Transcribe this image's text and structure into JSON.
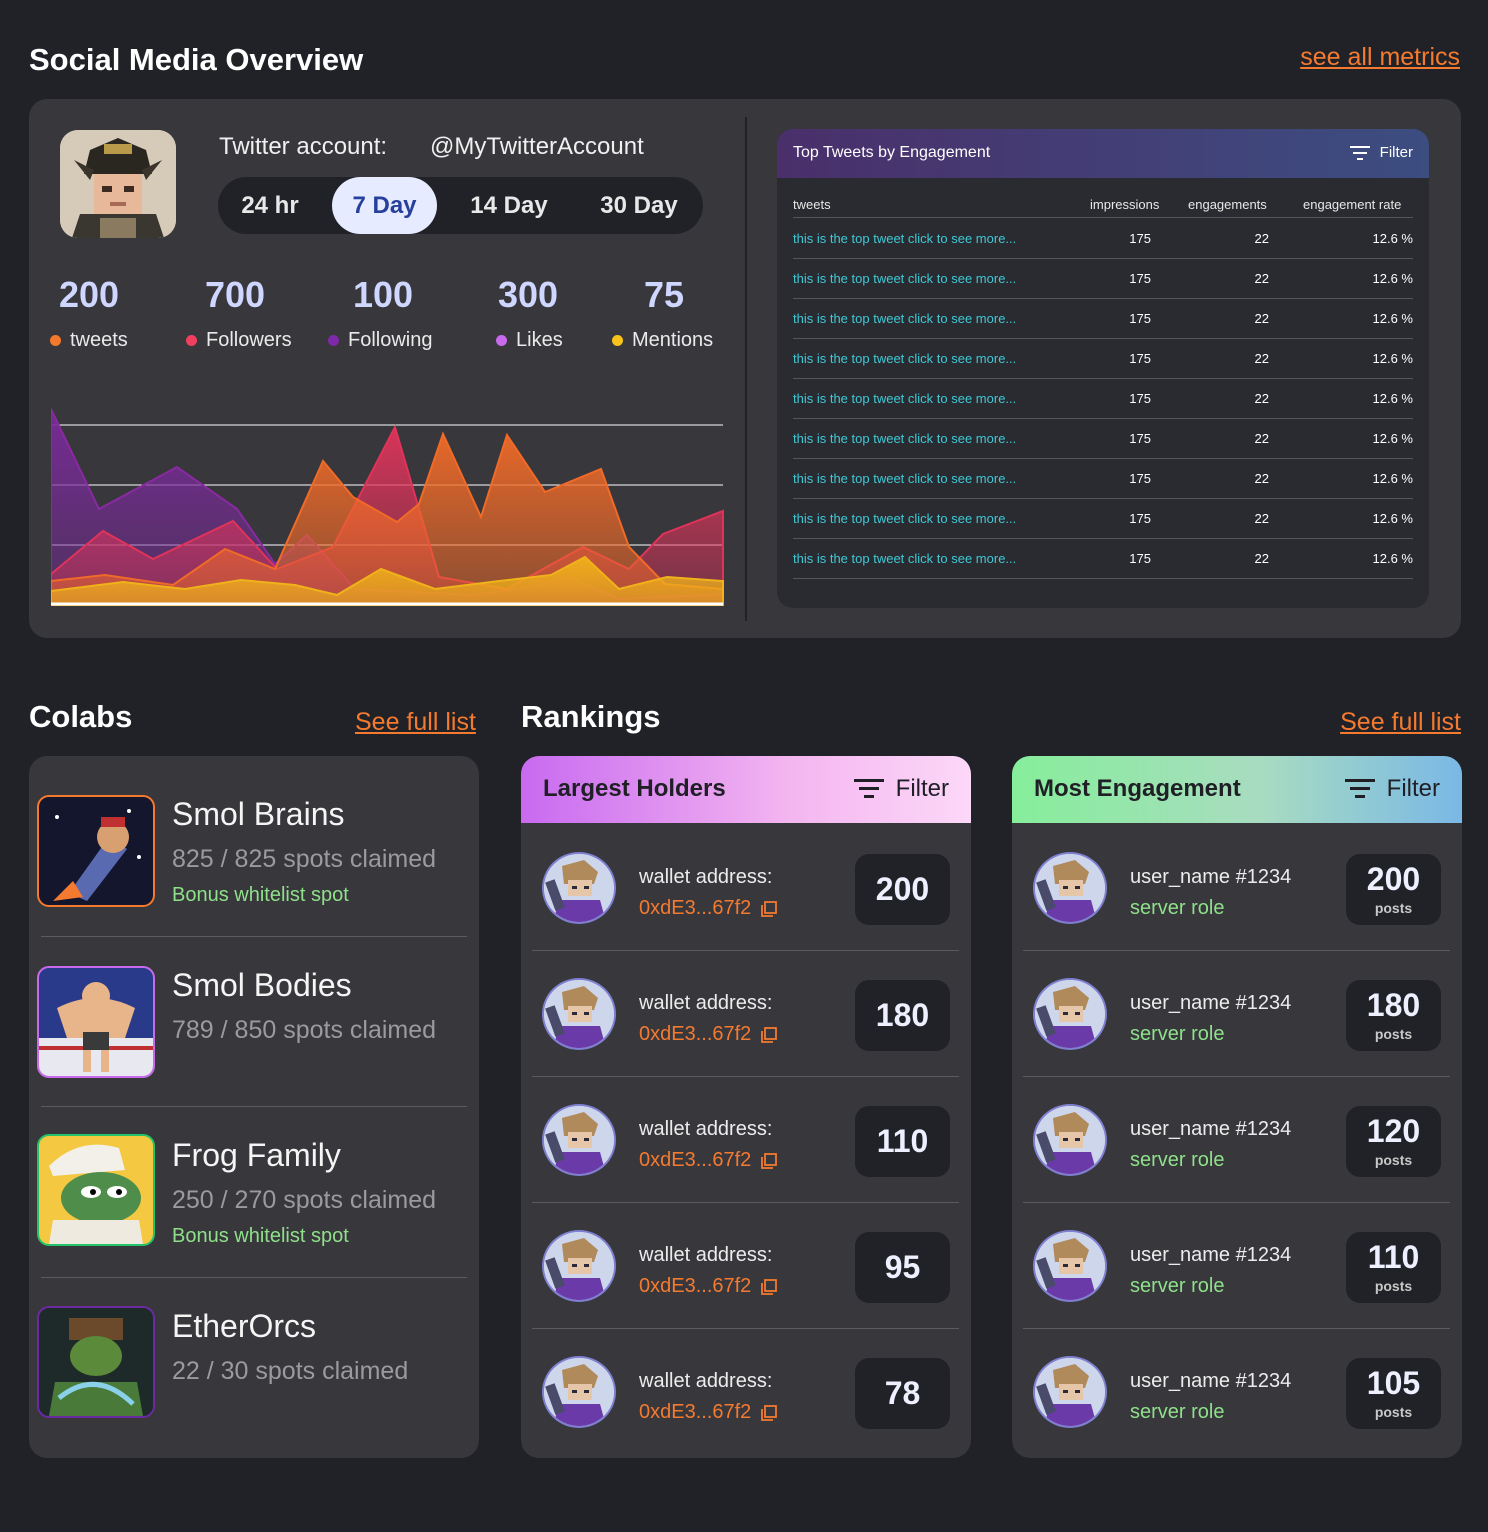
{
  "overview": {
    "title": "Social Media Overview",
    "see_all": "see all metrics",
    "twitter_label": "Twitter account:",
    "twitter_handle": "@MyTwitterAccount",
    "periods": [
      "24 hr",
      "7 Day",
      "14 Day",
      "30 Day"
    ],
    "active_period": "7 Day",
    "stats": [
      {
        "value": "200",
        "label": "tweets",
        "color": "#f4792c"
      },
      {
        "value": "700",
        "label": "Followers",
        "color": "#f33f5f"
      },
      {
        "value": "100",
        "label": "Following",
        "color": "#7d2aa8"
      },
      {
        "value": "300",
        "label": "Likes",
        "color": "#c76bea"
      },
      {
        "value": "75",
        "label": "Mentions",
        "color": "#f7c31a"
      }
    ]
  },
  "top_tweets": {
    "title": "Top Tweets by Engagement",
    "filter": "Filter",
    "columns": [
      "tweets",
      "impressions",
      "engagements",
      "engagement rate"
    ],
    "rows": [
      [
        "this is the top tweet click to see more...",
        "175",
        "22",
        "12.6 %"
      ],
      [
        "this is the top tweet click to see more...",
        "175",
        "22",
        "12.6 %"
      ],
      [
        "this is the top tweet click to see more...",
        "175",
        "22",
        "12.6 %"
      ],
      [
        "this is the top tweet click to see more...",
        "175",
        "22",
        "12.6 %"
      ],
      [
        "this is the top tweet click to see more...",
        "175",
        "22",
        "12.6 %"
      ],
      [
        "this is the top tweet click to see more...",
        "175",
        "22",
        "12.6 %"
      ],
      [
        "this is the top tweet click to see more...",
        "175",
        "22",
        "12.6 %"
      ],
      [
        "this is the top tweet click to see more...",
        "175",
        "22",
        "12.6 %"
      ],
      [
        "this is the top tweet click to see more...",
        "175",
        "22",
        "12.6 %"
      ]
    ]
  },
  "colabs": {
    "title": "Colabs",
    "see_full": "See full list",
    "items": [
      {
        "name": "Smol Brains",
        "spots": "825 / 825 spots claimed",
        "bonus": "Bonus whitelist spot",
        "border": "#f4792c"
      },
      {
        "name": "Smol Bodies",
        "spots": "789 / 850 spots claimed",
        "bonus": "",
        "border": "#c76bea"
      },
      {
        "name": "Frog Family",
        "spots": "250 / 270 spots claimed",
        "bonus": "Bonus whitelist spot",
        "border": "#23c26b"
      },
      {
        "name": "EtherOrcs",
        "spots": "22 / 30 spots claimed",
        "bonus": "",
        "border": "#6b2aa0"
      }
    ]
  },
  "rankings": {
    "title": "Rankings",
    "see_full": "See full list",
    "holders": {
      "title": "Largest Holders",
      "filter": "Filter",
      "rows": [
        {
          "label": "wallet address:",
          "address": "0xdE3...67f2",
          "value": "200"
        },
        {
          "label": "wallet address:",
          "address": "0xdE3...67f2",
          "value": "180"
        },
        {
          "label": "wallet address:",
          "address": "0xdE3...67f2",
          "value": "110"
        },
        {
          "label": "wallet address:",
          "address": "0xdE3...67f2",
          "value": "95"
        },
        {
          "label": "wallet address:",
          "address": "0xdE3...67f2",
          "value": "78"
        }
      ]
    },
    "engagement": {
      "title": "Most Engagement",
      "filter": "Filter",
      "unit": "posts",
      "rows": [
        {
          "user": "user_name #1234",
          "role": "server role",
          "value": "200"
        },
        {
          "user": "user_name #1234",
          "role": "server role",
          "value": "180"
        },
        {
          "user": "user_name #1234",
          "role": "server role",
          "value": "120"
        },
        {
          "user": "user_name #1234",
          "role": "server role",
          "value": "110"
        },
        {
          "user": "user_name #1234",
          "role": "server role",
          "value": "105"
        }
      ]
    }
  }
}
